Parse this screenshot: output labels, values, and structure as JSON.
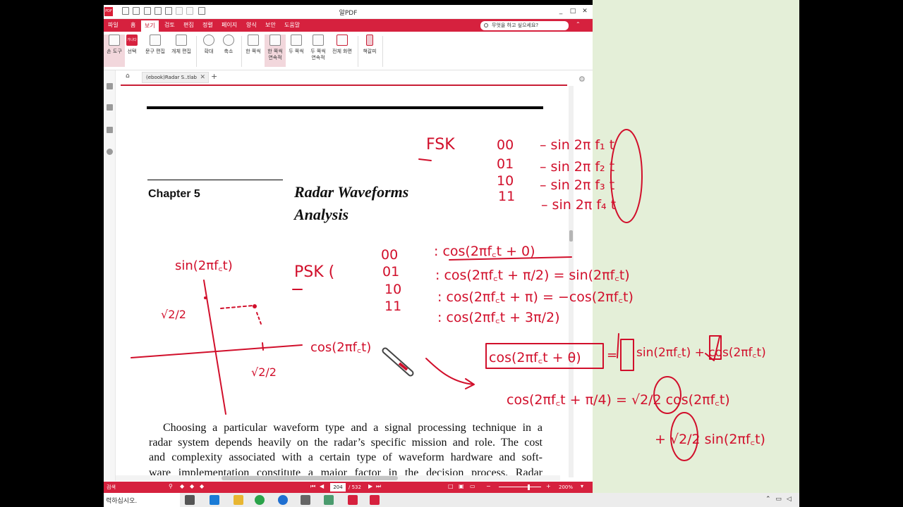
{
  "app": {
    "title": "알PDF",
    "logo": "PDF",
    "window_controls": [
      "_",
      "□",
      "✕"
    ],
    "menu": {
      "items": [
        "파일",
        "홈",
        "보기",
        "검토",
        "편집",
        "정렬",
        "페이지",
        "양식",
        "보안",
        "도움말"
      ],
      "active": "보기",
      "search_placeholder": "무엇을 하고 싶으세요?",
      "collapse": "⌃"
    },
    "ribbon": {
      "buttons": [
        "손 도구",
        "선택",
        "문구 편집",
        "개체 편집",
        "확대",
        "축소",
        "한 쪽씩",
        "한 쪽씩 연속적",
        "두 쪽씩",
        "두 쪽씩 연속적",
        "전체 화면",
        "책갈피"
      ],
      "selected": [
        "손 도구",
        "한 쪽씩 연속적"
      ],
      "select_badge": "가나다"
    },
    "tabs": {
      "home_icon": "home-icon",
      "doc_tab": "(ebook)Radar S..tlab",
      "close": "✕",
      "add": "+"
    },
    "statusbar": {
      "label": "검색",
      "current_page": "204",
      "total_pages": "/ 532",
      "zoom": "200%"
    },
    "accent_color": "#d6213e"
  },
  "document": {
    "chapter_label": "Chapter 5",
    "chapter_title_line1": "Radar Waveforms",
    "chapter_title_line2": "Analysis",
    "body_lines": [
      "Choosing a particular waveform type and a signal processing technique in a",
      "radar system depends heavily on the radar’s specific mission and role. The cost",
      "and complexity associated with a certain type of waveform hardware and soft-",
      "ware implementation constitute a major factor in the decision process. Radar"
    ]
  },
  "annotations": {
    "ink_color": "#d10f2b",
    "fsk_label": "FSK",
    "fsk_rows": [
      {
        "bits": "00",
        "expr": "– sin 2π f₁ t"
      },
      {
        "bits": "01",
        "expr": "– sin 2π f₂ t"
      },
      {
        "bits": "10",
        "expr": "– sin 2π f₃ t"
      },
      {
        "bits": "11",
        "expr": "– sin 2π f₄ t"
      }
    ],
    "psk_label": "PSK (",
    "psk_rows": [
      {
        "bits": "00",
        "expr": ": cos(2πf꜀t + 0)"
      },
      {
        "bits": "01",
        "expr": ": cos(2πf꜀t + π/2) = sin(2πf꜀t)"
      },
      {
        "bits": "10",
        "expr": ": cos(2πf꜀t + π) = −cos(2πf꜀t)"
      },
      {
        "bits": "11",
        "expr": ": cos(2πf꜀t + 3π/2)"
      }
    ],
    "axis_y_label": "sin(2πf꜀t)",
    "axis_x_label": "cos(2πf꜀t)",
    "root2_over_2": "√2/2",
    "boxed_expr": "cos(2πf꜀t + θ)",
    "rhs_terms": "sin(2πf꜀t) + cos(2πf꜀t)",
    "example_line1": "cos(2πf꜀t + π/4) = √2/2 cos(2πf꜀t)",
    "example_line2": "+ √2/2 sin(2πf꜀t)"
  },
  "taskbar": {
    "search_text": "력하십시오.",
    "tray_icons": [
      "chevron-up-icon",
      "network-icon",
      "speaker-icon"
    ]
  }
}
